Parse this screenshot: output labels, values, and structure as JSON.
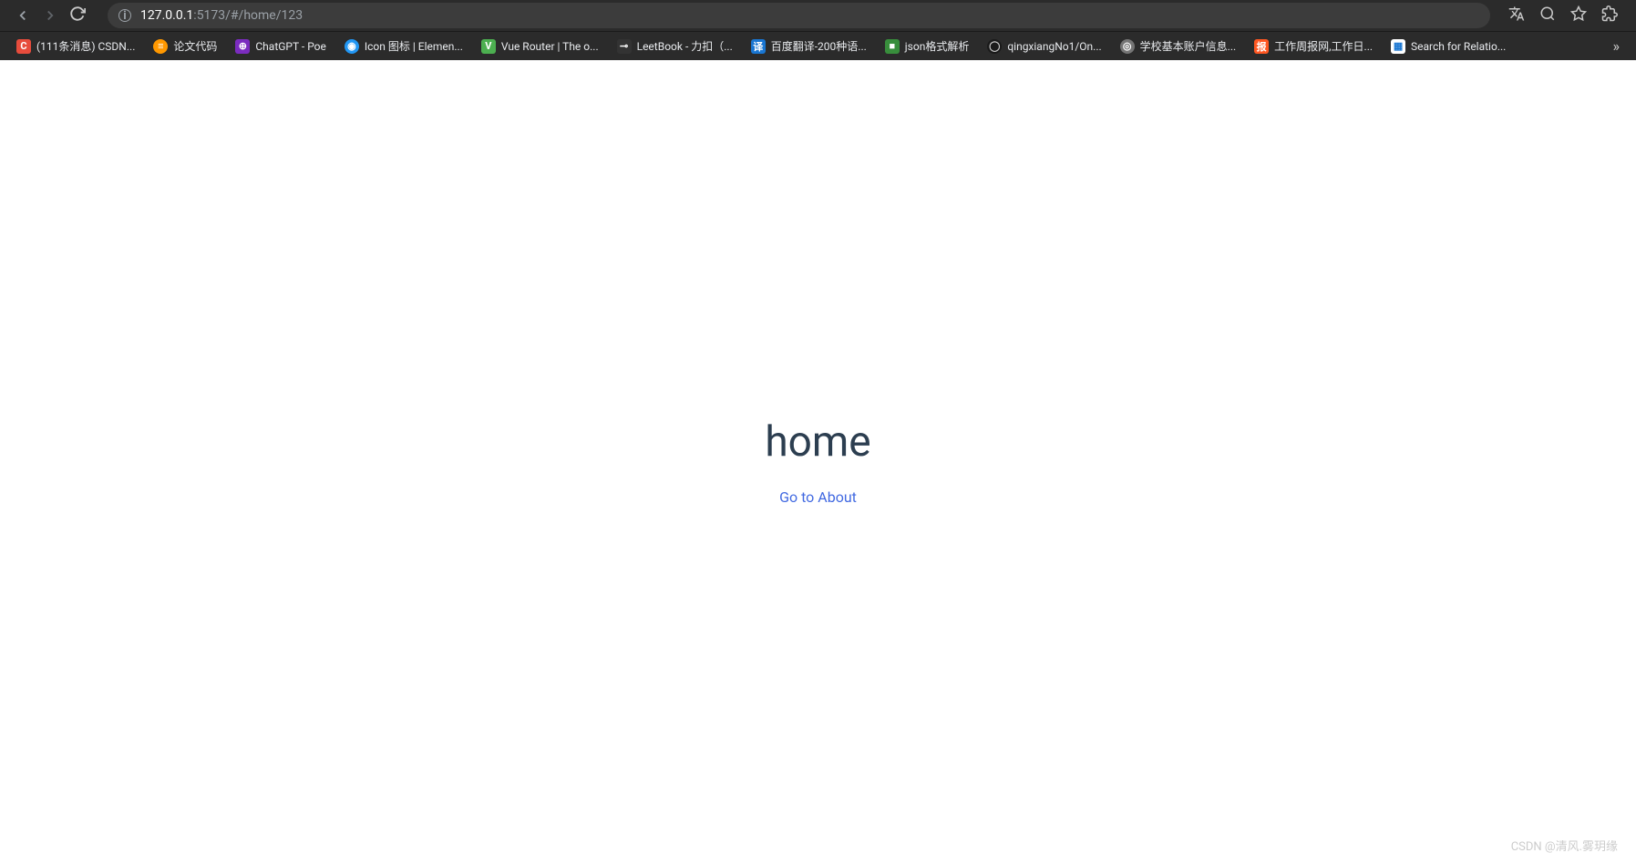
{
  "browser": {
    "url_host": "127.0.0.1",
    "url_port_path": ":5173/#/home/123"
  },
  "bookmarks": [
    {
      "label": "(111条消息) CSDN...",
      "favicon_class": "favicon-csdn",
      "favicon_char": "C"
    },
    {
      "label": "论文代码",
      "favicon_class": "favicon-orange",
      "favicon_char": "≡"
    },
    {
      "label": "ChatGPT - Poe",
      "favicon_class": "favicon-purple",
      "favicon_char": "⊕"
    },
    {
      "label": "Icon 图标 | Elemen...",
      "favicon_class": "favicon-blue",
      "favicon_char": "◉"
    },
    {
      "label": "Vue Router | The o...",
      "favicon_class": "favicon-green",
      "favicon_char": "V"
    },
    {
      "label": "LeetBook - 力扣（...",
      "favicon_class": "favicon-dark",
      "favicon_char": "⊸"
    },
    {
      "label": "百度翻译-200种语...",
      "favicon_class": "favicon-blue2",
      "favicon_char": "译"
    },
    {
      "label": "json格式解析",
      "favicon_class": "favicon-green2",
      "favicon_char": "■"
    },
    {
      "label": "qingxiangNo1/On...",
      "favicon_class": "favicon-github",
      "favicon_char": "◯"
    },
    {
      "label": "学校基本账户信息...",
      "favicon_class": "favicon-gray",
      "favicon_char": "◎"
    },
    {
      "label": "工作周报网,工作日...",
      "favicon_class": "favicon-orange2",
      "favicon_char": "报"
    },
    {
      "label": "Search for Relatio...",
      "favicon_class": "favicon-white",
      "favicon_char": "▦"
    }
  ],
  "page": {
    "heading": "home",
    "link_text": "Go to About"
  },
  "watermark": "CSDN @清风.雾玥缘"
}
